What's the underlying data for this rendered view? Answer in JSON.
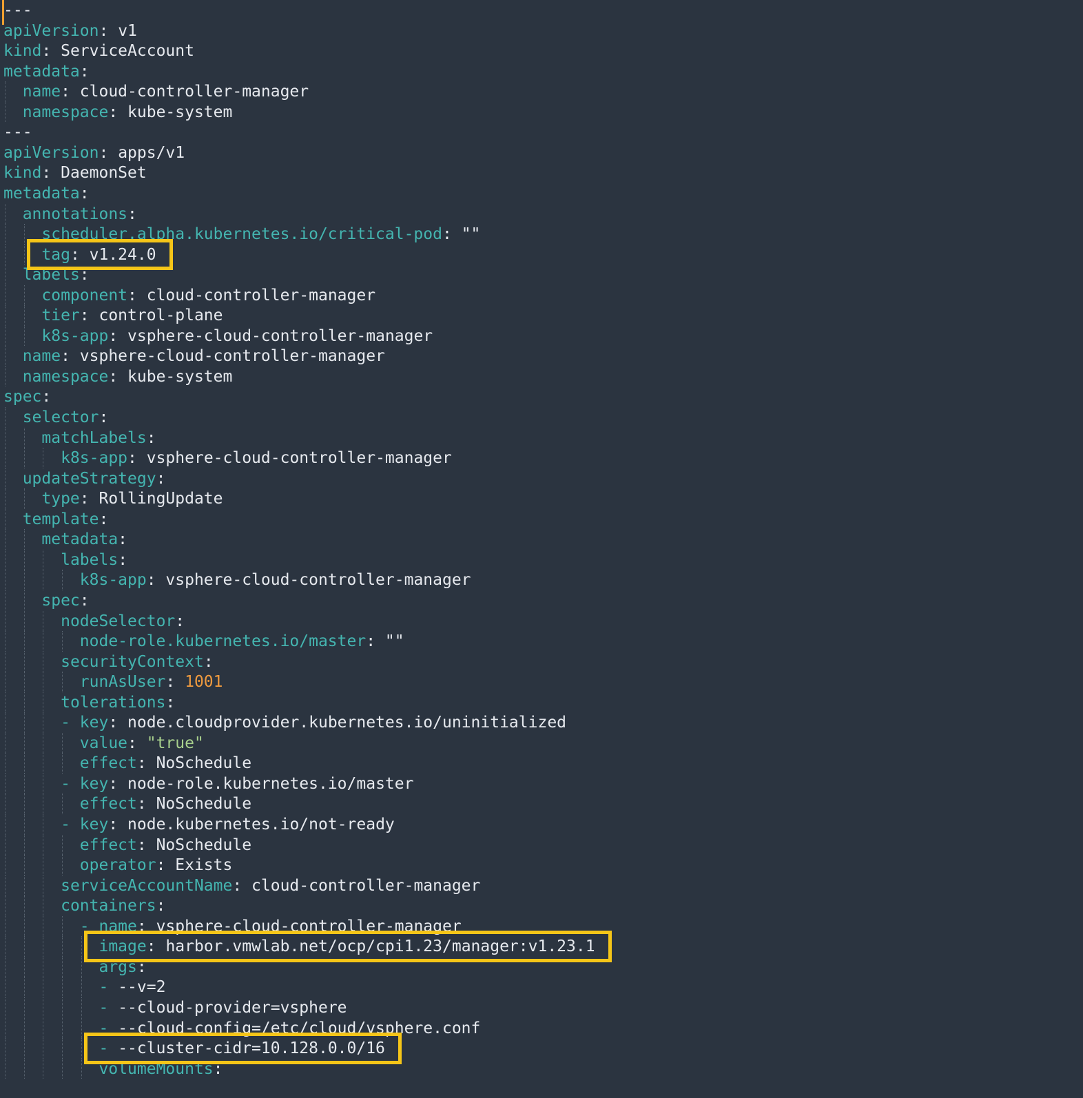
{
  "editor": {
    "language": "yaml",
    "lines": [
      {
        "indent": 0,
        "key": "---",
        "sep": "",
        "value": "",
        "vtype": "v",
        "dash": false
      },
      {
        "indent": 0,
        "key": "apiVersion",
        "sep": ": ",
        "value": "v1",
        "vtype": "v",
        "dash": false
      },
      {
        "indent": 0,
        "key": "kind",
        "sep": ": ",
        "value": "ServiceAccount",
        "vtype": "v",
        "dash": false
      },
      {
        "indent": 0,
        "key": "metadata",
        "sep": ":",
        "value": "",
        "vtype": "v",
        "dash": false
      },
      {
        "indent": 1,
        "key": "name",
        "sep": ": ",
        "value": "cloud-controller-manager",
        "vtype": "v",
        "dash": false
      },
      {
        "indent": 1,
        "key": "namespace",
        "sep": ": ",
        "value": "kube-system",
        "vtype": "v",
        "dash": false
      },
      {
        "indent": 0,
        "key": "---",
        "sep": "",
        "value": "",
        "vtype": "v",
        "dash": false
      },
      {
        "indent": 0,
        "key": "apiVersion",
        "sep": ": ",
        "value": "apps/v1",
        "vtype": "v",
        "dash": false
      },
      {
        "indent": 0,
        "key": "kind",
        "sep": ": ",
        "value": "DaemonSet",
        "vtype": "v",
        "dash": false
      },
      {
        "indent": 0,
        "key": "metadata",
        "sep": ":",
        "value": "",
        "vtype": "v",
        "dash": false
      },
      {
        "indent": 1,
        "key": "annotations",
        "sep": ":",
        "value": "",
        "vtype": "v",
        "dash": false
      },
      {
        "indent": 2,
        "key": "scheduler.alpha.kubernetes.io/critical-pod",
        "sep": ": ",
        "value": "\"\"",
        "vtype": "v",
        "dash": false
      },
      {
        "indent": 2,
        "key": "tag",
        "sep": ": ",
        "value": "v1.24.0",
        "vtype": "v",
        "dash": false
      },
      {
        "indent": 1,
        "key": "labels",
        "sep": ":",
        "value": "",
        "vtype": "v",
        "dash": false
      },
      {
        "indent": 2,
        "key": "component",
        "sep": ": ",
        "value": "cloud-controller-manager",
        "vtype": "v",
        "dash": false
      },
      {
        "indent": 2,
        "key": "tier",
        "sep": ": ",
        "value": "control-plane",
        "vtype": "v",
        "dash": false
      },
      {
        "indent": 2,
        "key": "k8s-app",
        "sep": ": ",
        "value": "vsphere-cloud-controller-manager",
        "vtype": "v",
        "dash": false
      },
      {
        "indent": 1,
        "key": "name",
        "sep": ": ",
        "value": "vsphere-cloud-controller-manager",
        "vtype": "v",
        "dash": false
      },
      {
        "indent": 1,
        "key": "namespace",
        "sep": ": ",
        "value": "kube-system",
        "vtype": "v",
        "dash": false
      },
      {
        "indent": 0,
        "key": "spec",
        "sep": ":",
        "value": "",
        "vtype": "v",
        "dash": false
      },
      {
        "indent": 1,
        "key": "selector",
        "sep": ":",
        "value": "",
        "vtype": "v",
        "dash": false
      },
      {
        "indent": 2,
        "key": "matchLabels",
        "sep": ":",
        "value": "",
        "vtype": "v",
        "dash": false
      },
      {
        "indent": 3,
        "key": "k8s-app",
        "sep": ": ",
        "value": "vsphere-cloud-controller-manager",
        "vtype": "v",
        "dash": false
      },
      {
        "indent": 1,
        "key": "updateStrategy",
        "sep": ":",
        "value": "",
        "vtype": "v",
        "dash": false
      },
      {
        "indent": 2,
        "key": "type",
        "sep": ": ",
        "value": "RollingUpdate",
        "vtype": "v",
        "dash": false
      },
      {
        "indent": 1,
        "key": "template",
        "sep": ":",
        "value": "",
        "vtype": "v",
        "dash": false
      },
      {
        "indent": 2,
        "key": "metadata",
        "sep": ":",
        "value": "",
        "vtype": "v",
        "dash": false
      },
      {
        "indent": 3,
        "key": "labels",
        "sep": ":",
        "value": "",
        "vtype": "v",
        "dash": false
      },
      {
        "indent": 4,
        "key": "k8s-app",
        "sep": ": ",
        "value": "vsphere-cloud-controller-manager",
        "vtype": "v",
        "dash": false
      },
      {
        "indent": 2,
        "key": "spec",
        "sep": ":",
        "value": "",
        "vtype": "v",
        "dash": false
      },
      {
        "indent": 3,
        "key": "nodeSelector",
        "sep": ":",
        "value": "",
        "vtype": "v",
        "dash": false
      },
      {
        "indent": 4,
        "key": "node-role.kubernetes.io/master",
        "sep": ": ",
        "value": "\"\"",
        "vtype": "v",
        "dash": false
      },
      {
        "indent": 3,
        "key": "securityContext",
        "sep": ":",
        "value": "",
        "vtype": "v",
        "dash": false
      },
      {
        "indent": 4,
        "key": "runAsUser",
        "sep": ": ",
        "value": "1001",
        "vtype": "n",
        "dash": false
      },
      {
        "indent": 3,
        "key": "tolerations",
        "sep": ":",
        "value": "",
        "vtype": "v",
        "dash": false
      },
      {
        "indent": 3,
        "key": "key",
        "sep": ": ",
        "value": "node.cloudprovider.kubernetes.io/uninitialized",
        "vtype": "v",
        "dash": true
      },
      {
        "indent": 4,
        "key": "value",
        "sep": ": ",
        "value": "\"true\"",
        "vtype": "s",
        "dash": false
      },
      {
        "indent": 4,
        "key": "effect",
        "sep": ": ",
        "value": "NoSchedule",
        "vtype": "v",
        "dash": false
      },
      {
        "indent": 3,
        "key": "key",
        "sep": ": ",
        "value": "node-role.kubernetes.io/master",
        "vtype": "v",
        "dash": true
      },
      {
        "indent": 4,
        "key": "effect",
        "sep": ": ",
        "value": "NoSchedule",
        "vtype": "v",
        "dash": false
      },
      {
        "indent": 3,
        "key": "key",
        "sep": ": ",
        "value": "node.kubernetes.io/not-ready",
        "vtype": "v",
        "dash": true
      },
      {
        "indent": 4,
        "key": "effect",
        "sep": ": ",
        "value": "NoSchedule",
        "vtype": "v",
        "dash": false
      },
      {
        "indent": 4,
        "key": "operator",
        "sep": ": ",
        "value": "Exists",
        "vtype": "v",
        "dash": false
      },
      {
        "indent": 3,
        "key": "serviceAccountName",
        "sep": ": ",
        "value": "cloud-controller-manager",
        "vtype": "v",
        "dash": false
      },
      {
        "indent": 3,
        "key": "containers",
        "sep": ":",
        "value": "",
        "vtype": "v",
        "dash": false
      },
      {
        "indent": 4,
        "key": "name",
        "sep": ": ",
        "value": "vsphere-cloud-controller-manager",
        "vtype": "v",
        "dash": true
      },
      {
        "indent": 5,
        "key": "image",
        "sep": ": ",
        "value": "harbor.vmwlab.net/ocp/cpi1.23/manager:v1.23.1",
        "vtype": "v",
        "dash": false
      },
      {
        "indent": 5,
        "key": "args",
        "sep": ":",
        "value": "",
        "vtype": "v",
        "dash": false
      },
      {
        "indent": 5,
        "key": "",
        "sep": "",
        "value": "--v=2",
        "vtype": "v",
        "dash": true
      },
      {
        "indent": 5,
        "key": "",
        "sep": "",
        "value": "--cloud-provider=vsphere",
        "vtype": "v",
        "dash": true
      },
      {
        "indent": 5,
        "key": "",
        "sep": "",
        "value": "--cloud-config=/etc/cloud/vsphere.conf",
        "vtype": "v",
        "dash": true
      },
      {
        "indent": 5,
        "key": "",
        "sep": "",
        "value": "--cluster-cidr=10.128.0.0/16",
        "vtype": "v",
        "dash": true
      },
      {
        "indent": 5,
        "key": "volumeMounts",
        "sep": ":",
        "value": "",
        "vtype": "v",
        "dash": false
      }
    ]
  },
  "highlights": [
    {
      "name": "highlight-tag-annotation",
      "line": 12
    },
    {
      "name": "highlight-image",
      "line": 46
    },
    {
      "name": "highlight-cluster-cidr",
      "line": 51
    }
  ],
  "colors": {
    "background": "#2b3440",
    "key": "#44b5b0",
    "value": "#e6e9ee",
    "number": "#ee9a3f",
    "string": "#a8d08d",
    "highlight_border": "#f5c518",
    "cursor": "#f0a030"
  }
}
